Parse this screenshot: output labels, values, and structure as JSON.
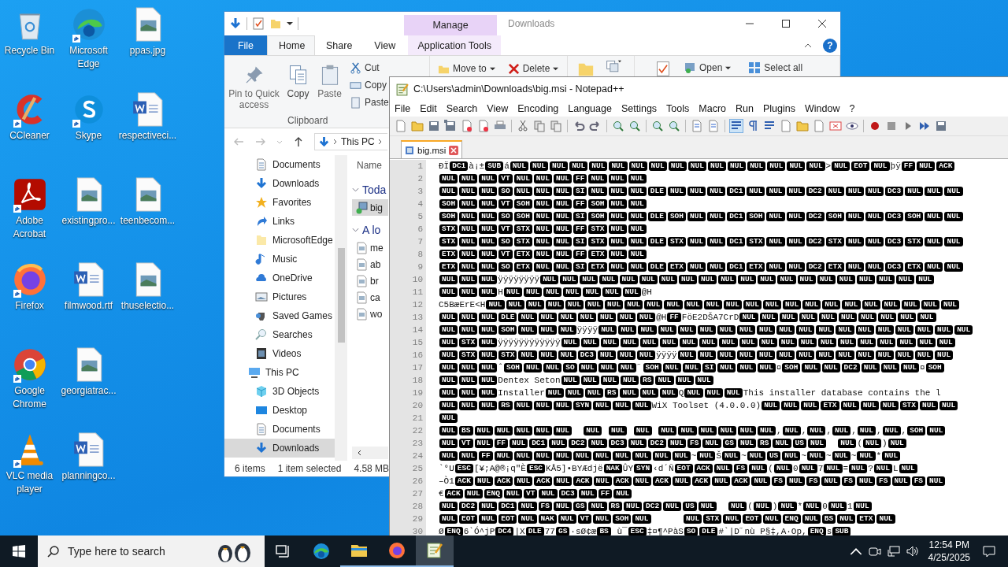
{
  "desktop": {
    "columns": [
      [
        {
          "label": "Recycle Bin",
          "kind": "recycle",
          "shortcut": false
        },
        {
          "label": "CCleaner",
          "kind": "ccleaner",
          "shortcut": true
        },
        {
          "label": "Adobe Acrobat",
          "kind": "acrobat",
          "shortcut": true
        },
        {
          "label": "Firefox",
          "kind": "firefox",
          "shortcut": true
        },
        {
          "label": "Google Chrome",
          "kind": "chrome",
          "shortcut": true
        },
        {
          "label": "VLC media player",
          "kind": "vlc",
          "shortcut": true
        }
      ],
      [
        {
          "label": "Microsoft Edge",
          "kind": "edge",
          "shortcut": true
        },
        {
          "label": "Skype",
          "kind": "skype",
          "shortcut": true
        },
        {
          "label": "existingpro...",
          "kind": "image",
          "shortcut": false
        },
        {
          "label": "filmwood.rtf",
          "kind": "word",
          "shortcut": false
        },
        {
          "label": "georgiatrac...",
          "kind": "image",
          "shortcut": false
        },
        {
          "label": "planningco...",
          "kind": "word",
          "shortcut": false
        }
      ],
      [
        {
          "label": "ppas.jpg",
          "kind": "image",
          "shortcut": false
        },
        {
          "label": "respectiveci...",
          "kind": "word",
          "shortcut": false
        },
        {
          "label": "teenbecom...",
          "kind": "image",
          "shortcut": false
        },
        {
          "label": "thuselectio...",
          "kind": "image",
          "shortcut": false
        }
      ]
    ]
  },
  "explorer": {
    "title": "Downloads",
    "context_group": "Manage",
    "help": "?",
    "tabs": [
      {
        "label": "File",
        "kind": "file",
        "selected": false
      },
      {
        "label": "Home",
        "kind": "tab",
        "selected": true
      },
      {
        "label": "Share",
        "kind": "tab",
        "selected": false
      },
      {
        "label": "View",
        "kind": "tab",
        "selected": false
      },
      {
        "label": "Application Tools",
        "kind": "context",
        "selected": false
      }
    ],
    "clipboard": {
      "large": [
        {
          "label": "Pin to Quick access",
          "kind": "pin"
        },
        {
          "label": "Copy",
          "kind": "copy"
        },
        {
          "label": "Paste",
          "kind": "paste"
        }
      ],
      "small": [
        {
          "label": "Cut",
          "kind": "cut"
        },
        {
          "label": "Copy",
          "kind": "copypath"
        },
        {
          "label": "Paste",
          "kind": "shortcut"
        }
      ],
      "group_label": "Clipboard"
    },
    "organize": [
      {
        "label": "Move to",
        "kind": "move"
      },
      {
        "label": "Delete",
        "kind": "delete"
      }
    ],
    "open": "Open",
    "select_all": "Select all",
    "address": [
      "This PC"
    ],
    "nav_items": [
      {
        "label": "Documents",
        "kind": "documents",
        "selected": false
      },
      {
        "label": "Downloads",
        "kind": "downloads",
        "selected": false
      },
      {
        "label": "Favorites",
        "kind": "favorites",
        "selected": false
      },
      {
        "label": "Links",
        "kind": "links",
        "selected": false
      },
      {
        "label": "MicrosoftEdge",
        "kind": "folder",
        "selected": false
      },
      {
        "label": "Music",
        "kind": "music",
        "selected": false
      },
      {
        "label": "OneDrive",
        "kind": "onedrive",
        "selected": false
      },
      {
        "label": "Pictures",
        "kind": "pictures",
        "selected": false
      },
      {
        "label": "Saved Games",
        "kind": "games",
        "selected": false
      },
      {
        "label": "Searches",
        "kind": "searches",
        "selected": false
      },
      {
        "label": "Videos",
        "kind": "videos",
        "selected": false
      }
    ],
    "nav_tree": [
      {
        "label": "This PC",
        "kind": "pc",
        "selected": false,
        "children": [
          {
            "label": "3D Objects",
            "kind": "objects",
            "selected": false
          },
          {
            "label": "Desktop",
            "kind": "desktop",
            "selected": false
          },
          {
            "label": "Documents",
            "kind": "documents",
            "selected": false
          },
          {
            "label": "Downloads",
            "kind": "downloads",
            "selected": true
          }
        ]
      }
    ],
    "column_header": "Name",
    "groups": [
      {
        "label": "Toda",
        "files": [
          {
            "name": "big",
            "kind": "installer",
            "selected": true
          }
        ]
      },
      {
        "label": "A lo",
        "files": [
          {
            "name": "me",
            "kind": "image",
            "selected": false
          },
          {
            "name": "ab",
            "kind": "image",
            "selected": false
          },
          {
            "name": "br",
            "kind": "image",
            "selected": false
          },
          {
            "name": "ca",
            "kind": "image",
            "selected": false
          },
          {
            "name": "wo",
            "kind": "image",
            "selected": false
          }
        ]
      }
    ],
    "status": {
      "count": "6 items",
      "selection": "1 item selected",
      "size": "4.58 MB"
    }
  },
  "notepad": {
    "title": "C:\\Users\\admin\\Downloads\\big.msi - Notepad++",
    "menu": [
      "File",
      "Edit",
      "Search",
      "View",
      "Encoding",
      "Language",
      "Settings",
      "Tools",
      "Macro",
      "Run",
      "Plugins",
      "Window",
      "?"
    ],
    "tabs": [
      {
        "label": "big.msi",
        "selected": true
      }
    ],
    "lines": [
      {
        "number": "1",
        "segments": [
          {
            "kind": "text",
            "text": "ÐÏ"
          },
          {
            "kind": "control",
            "codes": [
              "DC1"
            ]
          },
          {
            "kind": "text",
            "text": "à¡±"
          },
          {
            "kind": "control",
            "codes": [
              "SUB"
            ]
          },
          {
            "kind": "text",
            "text": "á"
          },
          {
            "kind": "control",
            "codes": [
              "NUL",
              "NUL",
              "NUL",
              "NUL",
              "NUL",
              "NUL",
              "NUL",
              "NUL",
              "NUL",
              "NUL",
              "NUL",
              "NUL",
              "NUL",
              "NUL",
              "NUL",
              "NUL"
            ]
          },
          {
            "kind": "text",
            "text": ">"
          },
          {
            "kind": "control",
            "codes": [
              "NUL",
              "EOT",
              "NUL"
            ]
          },
          {
            "kind": "text",
            "text": "þÿ"
          },
          {
            "kind": "control",
            "codes": [
              "FF",
              "NUL",
              "ACK"
            ]
          }
        ]
      },
      {
        "number": "2",
        "segments": [
          {
            "kind": "control",
            "codes": [
              "NUL",
              "NUL",
              "NUL",
              "VT",
              "NUL",
              "NUL",
              "NUL",
              "FF",
              "NUL",
              "NUL",
              "NUL"
            ]
          }
        ]
      },
      {
        "number": "3",
        "segments": [
          {
            "kind": "control",
            "codes": [
              "NUL",
              "NUL",
              "NUL",
              "SO",
              "NUL",
              "NUL",
              "NUL",
              "SI",
              "NUL",
              "NUL",
              "NUL",
              "DLE",
              "NUL",
              "NUL",
              "NUL",
              "DC1",
              "NUL",
              "NUL",
              "NUL",
              "DC2",
              "NUL",
              "NUL",
              "NUL",
              "DC3",
              "NUL",
              "NUL",
              "NUL"
            ]
          }
        ]
      },
      {
        "number": "4",
        "segments": [
          {
            "kind": "control",
            "codes": [
              "SOH",
              "NUL",
              "NUL",
              "VT",
              "SOH",
              "NUL",
              "NUL",
              "FF",
              "SOH",
              "NUL",
              "NUL"
            ]
          }
        ]
      },
      {
        "number": "5",
        "segments": [
          {
            "kind": "control",
            "codes": [
              "SOH",
              "NUL",
              "NUL",
              "SO",
              "SOH",
              "NUL",
              "NUL",
              "SI",
              "SOH",
              "NUL",
              "NUL",
              "DLE",
              "SOH",
              "NUL",
              "NUL",
              "DC1",
              "SOH",
              "NUL",
              "NUL",
              "DC2",
              "SOH",
              "NUL",
              "NUL",
              "DC3",
              "SOH",
              "NUL",
              "NUL"
            ]
          }
        ]
      },
      {
        "number": "6",
        "segments": [
          {
            "kind": "control",
            "codes": [
              "STX",
              "NUL",
              "NUL",
              "VT",
              "STX",
              "NUL",
              "NUL",
              "FF",
              "STX",
              "NUL",
              "NUL"
            ]
          }
        ]
      },
      {
        "number": "7",
        "segments": [
          {
            "kind": "control",
            "codes": [
              "STX",
              "NUL",
              "NUL",
              "SO",
              "STX",
              "NUL",
              "NUL",
              "SI",
              "STX",
              "NUL",
              "NUL",
              "DLE",
              "STX",
              "NUL",
              "NUL",
              "DC1",
              "STX",
              "NUL",
              "NUL",
              "DC2",
              "STX",
              "NUL",
              "NUL",
              "DC3",
              "STX",
              "NUL",
              "NUL"
            ]
          }
        ]
      },
      {
        "number": "8",
        "segments": [
          {
            "kind": "control",
            "codes": [
              "ETX",
              "NUL",
              "NUL",
              "VT",
              "ETX",
              "NUL",
              "NUL",
              "FF",
              "ETX",
              "NUL",
              "NUL"
            ]
          }
        ]
      },
      {
        "number": "9",
        "segments": [
          {
            "kind": "control",
            "codes": [
              "ETX",
              "NUL",
              "NUL",
              "SO",
              "ETX",
              "NUL",
              "NUL",
              "SI",
              "ETX",
              "NUL",
              "NUL",
              "DLE",
              "ETX",
              "NUL",
              "NUL",
              "DC1",
              "ETX",
              "NUL",
              "NUL",
              "DC2",
              "ETX",
              "NUL",
              "NUL",
              "DC3",
              "ETX",
              "NUL",
              "NUL"
            ]
          }
        ]
      },
      {
        "number": "10",
        "segments": [
          {
            "kind": "control",
            "codes": [
              "NUL",
              "NUL",
              "NUL"
            ]
          },
          {
            "kind": "text",
            "text": "ÿÿÿÿÿÿÿÿ"
          },
          {
            "kind": "control",
            "codes": [
              "NUL",
              "NUL",
              "NUL",
              "NUL",
              "NUL",
              "NUL",
              "NUL",
              "NUL",
              "NUL",
              "NUL",
              "NUL",
              "NUL",
              "NUL",
              "NUL",
              "NUL",
              "NUL",
              "NUL",
              "NUL",
              "NUL",
              "NUL"
            ]
          }
        ]
      },
      {
        "number": "11",
        "segments": [
          {
            "kind": "control",
            "codes": [
              "NUL",
              "NUL",
              "NUL"
            ]
          },
          {
            "kind": "text",
            "text": "H"
          },
          {
            "kind": "control",
            "codes": [
              "NUL",
              "NUL",
              "NUL",
              "NUL",
              "NUL",
              "NUL",
              "NUL"
            ]
          },
          {
            "kind": "text",
            "text": "@H"
          }
        ]
      },
      {
        "number": "12",
        "segments": [
          {
            "kind": "text",
            "text": "C5BæErE<H"
          },
          {
            "kind": "control",
            "codes": [
              "NUL",
              "NUL",
              "NUL",
              "NUL",
              "NUL",
              "NUL",
              "NUL",
              "NUL",
              "NUL",
              "NUL",
              "NUL",
              "NUL",
              "NUL",
              "NUL",
              "NUL",
              "NUL",
              "NUL",
              "NUL",
              "NUL",
              "NUL",
              "NUL",
              "NUL",
              "NUL",
              "NUL"
            ]
          }
        ]
      },
      {
        "number": "13",
        "segments": [
          {
            "kind": "control",
            "codes": [
              "NUL",
              "NUL",
              "NUL",
              "DLE",
              "NUL",
              "NUL",
              "NUL",
              "NUL",
              "NUL",
              "NUL",
              "NUL"
            ]
          },
          {
            "kind": "text",
            "text": "@H"
          },
          {
            "kind": "control",
            "codes": [
              "FF"
            ]
          },
          {
            "kind": "text",
            "text": "FöE2DŠA7CrD"
          },
          {
            "kind": "control",
            "codes": [
              "NUL",
              "NUL",
              "NUL",
              "NUL",
              "NUL",
              "NUL",
              "NUL",
              "NUL",
              "NUL",
              "NUL"
            ]
          }
        ]
      },
      {
        "number": "14",
        "segments": [
          {
            "kind": "control",
            "codes": [
              "NUL",
              "NUL",
              "NUL",
              "SOH",
              "NUL",
              "NUL",
              "NUL"
            ]
          },
          {
            "kind": "text",
            "text": "ÿÿÿÿ"
          },
          {
            "kind": "control",
            "codes": [
              "NUL",
              "NUL",
              "NUL",
              "NUL",
              "NUL",
              "NUL",
              "NUL",
              "NUL",
              "NUL",
              "NUL",
              "NUL",
              "NUL",
              "NUL",
              "NUL",
              "NUL",
              "NUL",
              "NUL",
              "NUL",
              "NUL"
            ]
          }
        ]
      },
      {
        "number": "15",
        "segments": [
          {
            "kind": "control",
            "codes": [
              "NUL",
              "STX",
              "NUL"
            ]
          },
          {
            "kind": "text",
            "text": "ÿÿÿÿÿÿÿÿÿÿÿÿ"
          },
          {
            "kind": "control",
            "codes": [
              "NUL",
              "NUL",
              "NUL",
              "NUL",
              "NUL",
              "NUL",
              "NUL",
              "NUL",
              "NUL",
              "NUL",
              "NUL",
              "NUL",
              "NUL",
              "NUL",
              "NUL",
              "NUL",
              "NUL",
              "NUL",
              "NUL",
              "NUL"
            ]
          }
        ]
      },
      {
        "number": "16",
        "segments": [
          {
            "kind": "control",
            "codes": [
              "NUL",
              "STX",
              "NUL",
              "STX",
              "NUL",
              "NUL",
              "NUL",
              "DC3",
              "NUL",
              "NUL",
              "NUL"
            ]
          },
          {
            "kind": "text",
            "text": "ÿÿÿÿ"
          },
          {
            "kind": "control",
            "codes": [
              "NUL",
              "NUL",
              "NUL",
              "NUL",
              "NUL",
              "NUL",
              "NUL",
              "NUL",
              "NUL",
              "NUL",
              "NUL",
              "NUL",
              "NUL",
              "NUL"
            ]
          }
        ]
      },
      {
        "number": "17",
        "segments": [
          {
            "kind": "control",
            "codes": [
              "NUL",
              "NUL",
              "NUL"
            ]
          },
          {
            "kind": "text",
            "text": "ˆ"
          },
          {
            "kind": "control",
            "codes": [
              "SOH",
              "NUL",
              "NUL",
              "SO",
              "NUL",
              "NUL",
              "NUL"
            ]
          },
          {
            "kind": "text",
            "text": "˝"
          },
          {
            "kind": "control",
            "codes": [
              "SOH",
              "NUL",
              "NUL",
              "SI",
              "NUL",
              "NUL",
              "NUL"
            ]
          },
          {
            "kind": "text",
            "text": "¤"
          },
          {
            "kind": "control",
            "codes": [
              "SOH",
              "NUL",
              "NUL",
              "DC2",
              "NUL",
              "NUL",
              "NUL"
            ]
          },
          {
            "kind": "text",
            "text": "¤"
          },
          {
            "kind": "control",
            "codes": [
              "SOH"
            ]
          }
        ]
      },
      {
        "number": "18",
        "segments": [
          {
            "kind": "control",
            "codes": [
              "NUL",
              "NUL",
              "NUL"
            ]
          },
          {
            "kind": "text",
            "text": "Dentex Seton"
          },
          {
            "kind": "control",
            "codes": [
              "NUL",
              "NUL",
              "NUL",
              "NUL",
              "RS",
              "NUL",
              "NUL",
              "NUL"
            ]
          }
        ]
      },
      {
        "number": "19",
        "segments": [
          {
            "kind": "control",
            "codes": [
              "NUL",
              "NUL",
              "NUL"
            ]
          },
          {
            "kind": "text",
            "text": "Installer"
          },
          {
            "kind": "control",
            "codes": [
              "NUL",
              "NUL",
              "NUL",
              "RS",
              "NUL",
              "NUL",
              "NUL"
            ]
          },
          {
            "kind": "text",
            "text": "Q"
          },
          {
            "kind": "control",
            "codes": [
              "NUL",
              "NUL",
              "NUL"
            ]
          },
          {
            "kind": "text",
            "text": "This installer database contains the l"
          }
        ]
      },
      {
        "number": "20",
        "segments": [
          {
            "kind": "control",
            "codes": [
              "NUL",
              "NUL",
              "NUL",
              "RS",
              "NUL",
              "NUL",
              "NUL",
              "SYN",
              "NUL",
              "NUL",
              "NUL"
            ]
          },
          {
            "kind": "text",
            "text": "WiX Toolset (4.0.0.0)"
          },
          {
            "kind": "control",
            "codes": [
              "NUL",
              "NUL",
              "NUL",
              "ETX",
              "NUL",
              "NUL",
              "NUL",
              "STX",
              "NUL",
              "NUL"
            ]
          }
        ]
      },
      {
        "number": "21",
        "segments": [
          {
            "kind": "control",
            "codes": [
              "NUL"
            ]
          }
        ]
      },
      {
        "number": "22",
        "segments": [
          {
            "kind": "control",
            "codes": [
              "NUL",
              "BS",
              "NUL",
              "NUL",
              "NUL",
              "NUL",
              "NUL"
            ]
          },
          {
            "kind": "gap"
          },
          {
            "kind": "gap"
          },
          {
            "kind": "control",
            "codes": [
              "NUL"
            ]
          },
          {
            "kind": "gap"
          },
          {
            "kind": "control",
            "codes": [
              "NUL"
            ]
          },
          {
            "kind": "gap"
          },
          {
            "kind": "control",
            "codes": [
              "NUL"
            ]
          },
          {
            "kind": "gap"
          },
          {
            "kind": "control",
            "codes": [
              "NUL",
              "NUL",
              "NUL",
              "NUL",
              "NUL",
              "NUL"
            ]
          },
          {
            "kind": "text",
            "text": ","
          },
          {
            "kind": "control",
            "codes": [
              "NUL"
            ]
          },
          {
            "kind": "text",
            "text": ","
          },
          {
            "kind": "control",
            "codes": [
              "NUL"
            ]
          },
          {
            "kind": "text",
            "text": ","
          },
          {
            "kind": "control",
            "codes": [
              "NUL"
            ]
          },
          {
            "kind": "text",
            "text": ","
          },
          {
            "kind": "control",
            "codes": [
              "NUL"
            ]
          },
          {
            "kind": "text",
            "text": ","
          },
          {
            "kind": "control",
            "codes": [
              "NUL"
            ]
          },
          {
            "kind": "text",
            "text": ","
          },
          {
            "kind": "control",
            "codes": [
              "SOH",
              "NUL"
            ]
          }
        ]
      },
      {
        "number": "23",
        "segments": [
          {
            "kind": "control",
            "codes": [
              "NUL",
              "VT",
              "NUL",
              "FF",
              "NUL",
              "DC1",
              "NUL",
              "DC2",
              "NUL",
              "DC3",
              "NUL",
              "DC2",
              "NUL",
              "FS",
              "NUL",
              "GS",
              "NUL",
              "RS",
              "NUL",
              "US",
              "NUL"
            ]
          },
          {
            "kind": "gap"
          },
          {
            "kind": "gap"
          },
          {
            "kind": "control",
            "codes": [
              "NUL"
            ]
          },
          {
            "kind": "text",
            "text": "("
          },
          {
            "kind": "control",
            "codes": [
              "NUL"
            ]
          },
          {
            "kind": "text",
            "text": ")"
          },
          {
            "kind": "control",
            "codes": [
              "NUL"
            ]
          }
        ]
      },
      {
        "number": "24",
        "segments": [
          {
            "kind": "control",
            "codes": [
              "NUL",
              "NUL",
              "FF",
              "NUL",
              "NUL",
              "NUL",
              "NUL",
              "NUL",
              "NUL",
              "NUL",
              "NUL",
              "NUL",
              "NUL"
            ]
          },
          {
            "kind": "text",
            "text": "~"
          },
          {
            "kind": "control",
            "codes": [
              "NUL"
            ]
          },
          {
            "kind": "text",
            "text": "Š"
          },
          {
            "kind": "control",
            "codes": [
              "NUL"
            ]
          },
          {
            "kind": "text",
            "text": "~"
          },
          {
            "kind": "control",
            "codes": [
              "NUL",
              "US",
              "NUL"
            ]
          },
          {
            "kind": "text",
            "text": "~"
          },
          {
            "kind": "control",
            "codes": [
              "NUL"
            ]
          },
          {
            "kind": "text",
            "text": "~"
          },
          {
            "kind": "control",
            "codes": [
              "NUL"
            ]
          },
          {
            "kind": "text",
            "text": "~"
          },
          {
            "kind": "control",
            "codes": [
              "NUL"
            ]
          },
          {
            "kind": "text",
            "text": "*"
          },
          {
            "kind": "control",
            "codes": [
              "NUL"
            ]
          }
        ]
      },
      {
        "number": "25",
        "segments": [
          {
            "kind": "text",
            "text": "`°U"
          },
          {
            "kind": "control",
            "codes": [
              "ESC"
            ]
          },
          {
            "kind": "text",
            "text": "[¥;A@®¡q\"È"
          },
          {
            "kind": "control",
            "codes": [
              "ESC"
            ]
          },
          {
            "kind": "text",
            "text": "KÅ5]•BYÆdjë"
          },
          {
            "kind": "control",
            "codes": [
              "NAK"
            ]
          },
          {
            "kind": "text",
            "text": "ÛY"
          },
          {
            "kind": "control",
            "codes": [
              "SYN"
            ]
          },
          {
            "kind": "text",
            "text": "‹d´Ñ"
          },
          {
            "kind": "control",
            "codes": [
              "EOT",
              "ACK",
              "NUL",
              "FS",
              "NUL"
            ]
          },
          {
            "kind": "text",
            "text": "("
          },
          {
            "kind": "control",
            "codes": [
              "NUL"
            ]
          },
          {
            "kind": "text",
            "text": "0"
          },
          {
            "kind": "control",
            "codes": [
              "NUL"
            ]
          },
          {
            "kind": "text",
            "text": "7"
          },
          {
            "kind": "control",
            "codes": [
              "NUL"
            ]
          },
          {
            "kind": "text",
            "text": "="
          },
          {
            "kind": "control",
            "codes": [
              "NUL"
            ]
          },
          {
            "kind": "text",
            "text": "?"
          },
          {
            "kind": "control",
            "codes": [
              "NUL"
            ]
          },
          {
            "kind": "text",
            "text": "L"
          },
          {
            "kind": "control",
            "codes": [
              "NUL"
            ]
          }
        ]
      },
      {
        "number": "26",
        "segments": [
          {
            "kind": "text",
            "text": "–Ò1"
          },
          {
            "kind": "control",
            "codes": [
              "ACK",
              "NUL",
              "ACK",
              "NUL",
              "ACK",
              "NUL",
              "ACK",
              "NUL",
              "ACK",
              "NUL",
              "ACK",
              "NUL",
              "ACK",
              "NUL",
              "ACK",
              "NUL",
              "FS",
              "NUL",
              "FS",
              "NUL",
              "FS",
              "NUL",
              "FS",
              "NUL",
              "FS",
              "NUL"
            ]
          }
        ]
      },
      {
        "number": "27",
        "segments": [
          {
            "kind": "text",
            "text": "€"
          },
          {
            "kind": "control",
            "codes": [
              "ACK",
              "NUL",
              "ENQ",
              "NUL",
              "VT",
              "NUL",
              "DC3",
              "NUL",
              "FF",
              "NUL"
            ]
          }
        ]
      },
      {
        "number": "28",
        "segments": [
          {
            "kind": "control",
            "codes": [
              "NUL",
              "DC2",
              "NUL",
              "DC1",
              "NUL",
              "FS",
              "NUL",
              "GS",
              "NUL",
              "RS",
              "NUL",
              "DC2",
              "NUL",
              "US",
              "NUL"
            ]
          },
          {
            "kind": "gap"
          },
          {
            "kind": "gap"
          },
          {
            "kind": "control",
            "codes": [
              "NUL"
            ]
          },
          {
            "kind": "text",
            "text": "("
          },
          {
            "kind": "control",
            "codes": [
              "NUL"
            ]
          },
          {
            "kind": "text",
            "text": ")"
          },
          {
            "kind": "control",
            "codes": [
              "NUL"
            ]
          },
          {
            "kind": "text",
            "text": "*"
          },
          {
            "kind": "control",
            "codes": [
              "NUL"
            ]
          },
          {
            "kind": "text",
            "text": "0"
          },
          {
            "kind": "control",
            "codes": [
              "NUL"
            ]
          },
          {
            "kind": "text",
            "text": "1"
          },
          {
            "kind": "control",
            "codes": [
              "NUL"
            ]
          }
        ]
      },
      {
        "number": "29",
        "segments": [
          {
            "kind": "control",
            "codes": [
              "NUL",
              "EOT",
              "NUL",
              "EOT",
              "NUL",
              "NAK",
              "NUL",
              "VT",
              "NUL",
              "SOH",
              "NUL"
            ]
          },
          {
            "kind": "gap"
          },
          {
            "kind": "gap"
          },
          {
            "kind": "gap"
          },
          {
            "kind": "gap"
          },
          {
            "kind": "gap"
          },
          {
            "kind": "gap"
          },
          {
            "kind": "control",
            "codes": [
              "NUL",
              "STX",
              "NUL",
              "EOT",
              "NUL",
              "ENQ",
              "NUL",
              "BS",
              "NUL",
              "ETX",
              "NUL"
            ]
          }
        ]
      },
      {
        "number": "30",
        "segments": [
          {
            "kind": "text",
            "text": "Ø"
          },
          {
            "kind": "control",
            "codes": [
              "ENQ"
            ]
          },
          {
            "kind": "text",
            "text": "6`Ó^jP"
          },
          {
            "kind": "control",
            "codes": [
              "DC4"
            ]
          },
          {
            "kind": "text",
            "text": "|X"
          },
          {
            "kind": "control",
            "codes": [
              "DLE"
            ]
          },
          {
            "kind": "text",
            "text": "77"
          },
          {
            "kind": "control",
            "codes": [
              "GS"
            ]
          },
          {
            "kind": "text",
            "text": "·sØ¢æ"
          },
          {
            "kind": "control",
            "codes": [
              "BS"
            ]
          },
          {
            "kind": "text",
            "text": " ù¯"
          },
          {
            "kind": "control",
            "codes": [
              "ESC"
            ]
          },
          {
            "kind": "text",
            "text": "‡¤¶^PàS"
          },
          {
            "kind": "control",
            "codes": [
              "SO",
              "DLE"
            ]
          },
          {
            "kind": "text",
            "text": "#`|D˝nù P§‡,A·Op,"
          },
          {
            "kind": "control",
            "codes": [
              "ENQ"
            ]
          },
          {
            "kind": "text",
            "text": "s"
          },
          {
            "kind": "control",
            "codes": [
              "SUB"
            ]
          }
        ]
      }
    ]
  },
  "taskbar": {
    "search_placeholder": "Type here to search",
    "apps": [
      {
        "kind": "taskview",
        "running": false,
        "active": false
      },
      {
        "kind": "edge",
        "running": false,
        "active": false
      },
      {
        "kind": "explorer",
        "running": true,
        "active": false
      },
      {
        "kind": "firefox",
        "running": true,
        "active": false
      },
      {
        "kind": "notepad",
        "running": true,
        "active": true
      }
    ],
    "time": "12:54 PM",
    "date": "4/25/2025"
  }
}
